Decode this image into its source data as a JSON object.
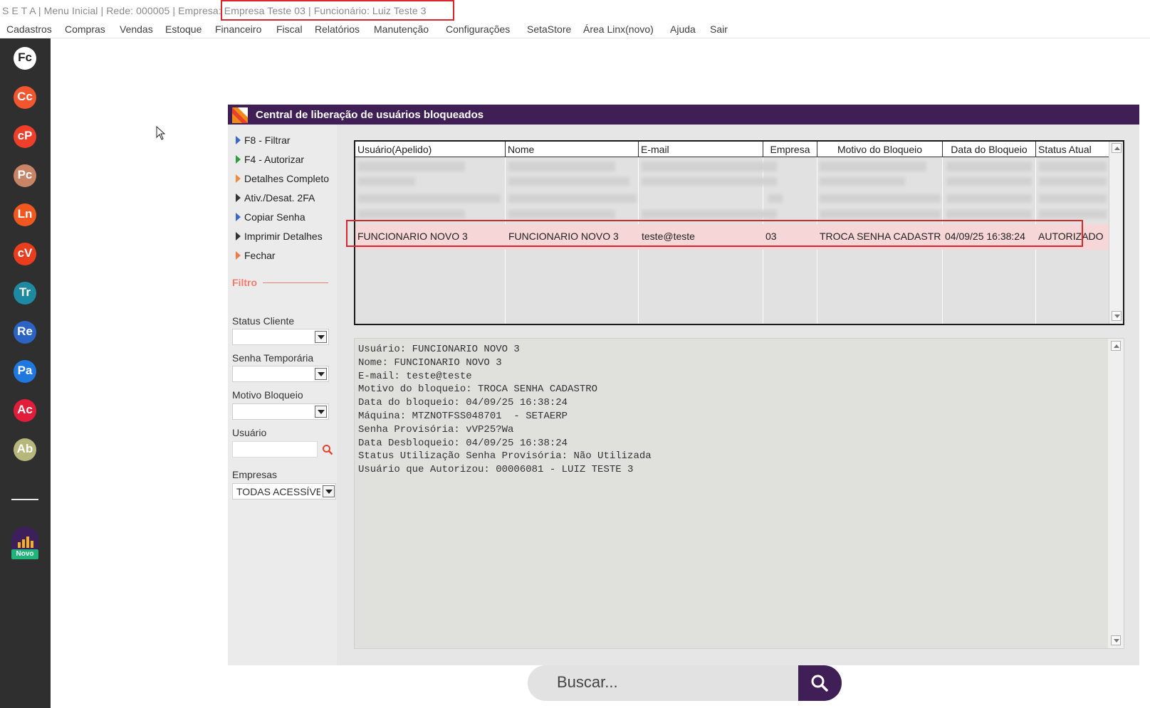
{
  "titlebar": {
    "text": "S E T A | Menu Inicial | Rede: 000005 | Empresa: Empresa Teste  03 | Funcionário: Luiz Teste 3"
  },
  "menu": [
    "Cadastros",
    "Compras",
    "Vendas",
    "Estoque",
    "Financeiro",
    "Fiscal",
    "Relatórios",
    "Manutenção",
    "Configurações",
    "SetaStore",
    "Área Linx(novo)",
    "Ajuda",
    "Sair"
  ],
  "dock": {
    "apps": [
      {
        "label": "Fc",
        "color": "#ffffff",
        "text_color": "#222222",
        "icon": "fc-app-icon"
      },
      {
        "label": "Cc",
        "color": "#f2562e",
        "text_color": "#ffffff",
        "icon": "cc-app-icon"
      },
      {
        "label": "cP",
        "color": "#ef3f2a",
        "text_color": "#ffffff",
        "icon": "cp-app-icon"
      },
      {
        "label": "Pc",
        "color": "#c88466",
        "text_color": "#ffffff",
        "icon": "pc-app-icon"
      },
      {
        "label": "Ln",
        "color": "#f0581f",
        "text_color": "#ffffff",
        "icon": "ln-app-icon"
      },
      {
        "label": "cV",
        "color": "#ea3d1d",
        "text_color": "#ffffff",
        "icon": "cv-app-icon"
      },
      {
        "label": "Tr",
        "color": "#1e8aa2",
        "text_color": "#ffffff",
        "icon": "tr-app-icon"
      },
      {
        "label": "Re",
        "color": "#2b64c4",
        "text_color": "#ffffff",
        "icon": "re-app-icon"
      },
      {
        "label": "Pa",
        "color": "#1f78e0",
        "text_color": "#ffffff",
        "icon": "pa-app-icon"
      },
      {
        "label": "Ac",
        "color": "#e21d3a",
        "text_color": "#ffffff",
        "icon": "ac-app-icon"
      },
      {
        "label": "Ab",
        "color": "#b7b77c",
        "text_color": "#ffffff",
        "icon": "ab-app-icon"
      }
    ],
    "novo_label": "Novo"
  },
  "dialog": {
    "title": "Central de liberação de usuários bloqueados",
    "commands": [
      {
        "label": "F8 - Filtrar",
        "color": "#3a68c8"
      },
      {
        "label": "F4 - Autorizar",
        "color": "#2c9e3a"
      },
      {
        "label": "Detalhes Completo",
        "color": "#f08a3c"
      },
      {
        "label": "Ativ./Desat. 2FA",
        "color": "#333333"
      },
      {
        "label": "Copiar Senha",
        "color": "#3a68c8"
      },
      {
        "label": "Imprimir Detalhes",
        "color": "#333333"
      },
      {
        "label": "Fechar",
        "color": "#f07a4a"
      }
    ],
    "filter": {
      "heading": "Filtro",
      "status_cliente_label": "Status Cliente",
      "senha_temporaria_label": "Senha Temporária",
      "motivo_bloqueio_label": "Motivo Bloqueio",
      "usuario_label": "Usuário",
      "empresas_label": "Empresas",
      "empresas_value": "TODAS ACESSÍVEIS"
    },
    "grid": {
      "columns": [
        "Usuário(Apelido)",
        "Nome",
        "E-mail",
        "Empresa",
        "Motivo do Bloqueio",
        "Data do Bloqueio",
        "Status Atual"
      ],
      "selected_row": [
        "FUNCIONARIO NOVO 3",
        "FUNCIONARIO NOVO 3",
        "teste@teste",
        "03",
        "TROCA SENHA CADASTRO",
        "04/09/25 16:38:24",
        "AUTORIZADO"
      ]
    },
    "details": [
      "Usuário: FUNCIONARIO NOVO 3",
      "Nome: FUNCIONARIO NOVO 3",
      "E-mail: teste@teste",
      "Motivo do bloqueio: TROCA SENHA CADASTRO",
      "Data do bloqueio: 04/09/25 16:38:24",
      "Máquina: MTZNOTFSS048701  - SETAERP",
      "Senha Provisória: vVP25?Wa",
      "Data Desbloqueio: 04/09/25 16:38:24",
      "Status Utilização Senha Provisória: Não Utilizada",
      "Usuário que Autorizou: 00006081 - LUIZ TESTE 3"
    ]
  },
  "search": {
    "placeholder": "Buscar..."
  },
  "colors": {
    "accent": "#3f1f55",
    "highlight_border": "#d9262c",
    "selected_row": "#f6d6d6"
  }
}
